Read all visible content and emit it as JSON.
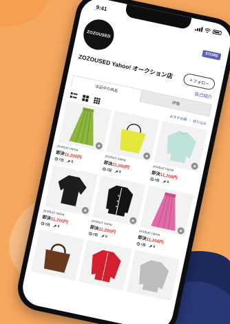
{
  "status_bar": {
    "time": "9:41"
  },
  "store": {
    "logo_text": "ZOZOUSED",
    "badge": "STORE",
    "name": "ZOZOUSED Yahoo! オークション店",
    "follow_label": "＋フォロー",
    "intro_label": "自己紹介"
  },
  "tabs": [
    {
      "label": "出品中の商品",
      "active": true
    },
    {
      "label": "評価",
      "active": false
    }
  ],
  "toolbar": {
    "sort_label": "おすすめ順",
    "filter_label": "絞り込み"
  },
  "icons": {
    "view_list": "list-view-icon",
    "view_grid_large": "grid-large-icon",
    "view_grid_small": "grid-small-icon",
    "favorite": "star-icon",
    "clock": "clock-icon",
    "bid": "gavel-icon"
  },
  "colors": {
    "background": "#f7a85f",
    "price": "#e8322b",
    "link": "#3b4fb8",
    "badge": "#5d5fb8"
  },
  "products": [
    {
      "name": "product name",
      "price_prefix": "即決",
      "price": "11,200円",
      "days": "7日",
      "bids": "0",
      "item": "green-skirt"
    },
    {
      "name": "product name",
      "price_prefix": "即決",
      "price": "11,200円",
      "days": "7日",
      "bids": "0",
      "item": "yellow-bag"
    },
    {
      "name": "product name",
      "price_prefix": "即決",
      "price": "11,200円",
      "days": "7日",
      "bids": "0",
      "item": "mint-sweater"
    },
    {
      "name": "product name",
      "price_prefix": "即決",
      "price": "11,200円",
      "days": "7日",
      "bids": "0",
      "item": "black-top"
    },
    {
      "name": "product name",
      "price_prefix": "即決",
      "price": "11,200円",
      "days": "7日",
      "bids": "0",
      "item": "black-jacket"
    },
    {
      "name": "product name",
      "price_prefix": "即決",
      "price": "11,200円",
      "days": "7日",
      "bids": "0",
      "item": "pink-skirt"
    },
    {
      "name": "",
      "price_prefix": "",
      "price": "",
      "days": "",
      "bids": "",
      "item": "brown-bag"
    },
    {
      "name": "",
      "price_prefix": "",
      "price": "",
      "days": "",
      "bids": "",
      "item": "red-cardigan"
    },
    {
      "name": "",
      "price_prefix": "",
      "price": "",
      "days": "",
      "bids": "",
      "item": "grey-sweater"
    }
  ]
}
